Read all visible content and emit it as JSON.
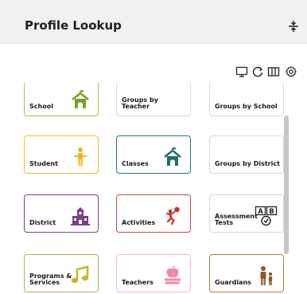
{
  "header": {
    "title": "Profile Lookup"
  },
  "icons": {
    "collapse": "collapse-vertical-icon",
    "monitor": "monitor-icon",
    "refresh": "refresh-icon",
    "columns": "columns-icon",
    "settings": "gear-icon"
  },
  "tiles": [
    {
      "label": "School",
      "icon": "school-building-icon",
      "border": "#b7bd3c",
      "icon_color": "#7a9d2a"
    },
    {
      "label": "Groups by Teacher",
      "icon": "",
      "border": "#d8d8d8",
      "icon_color": ""
    },
    {
      "label": "Groups by School",
      "icon": "",
      "border": "#d8d8d8",
      "icon_color": ""
    },
    {
      "label": "Student",
      "icon": "student-figure-icon",
      "border": "#f2c21b",
      "icon_color": "#f2b21b"
    },
    {
      "label": "Classes",
      "icon": "classroom-building-icon",
      "border": "#1f7c78",
      "icon_color": "#1f6f6a"
    },
    {
      "label": "Groups by District",
      "icon": "",
      "border": "#d8d8d8",
      "icon_color": ""
    },
    {
      "label": "District",
      "icon": "district-building-icon",
      "border": "#7b3e8f",
      "icon_color": "#7b3e8f"
    },
    {
      "label": "Activities",
      "icon": "activities-figure-icon",
      "border": "#c94a48",
      "icon_color": "#d0312d"
    },
    {
      "label": "Assessment Tests",
      "icon": "assessment-ab-icon",
      "border": "#d8d8d8",
      "icon_color": "#222222"
    },
    {
      "label": "Programs & Services",
      "icon": "music-note-icon",
      "border": "#b9b04a",
      "icon_color": "#c7b62c"
    },
    {
      "label": "Teachers",
      "icon": "apple-books-icon",
      "border": "#f3b6c7",
      "icon_color": "#f08aa6"
    },
    {
      "label": "Guardians",
      "icon": "guardians-figures-icon",
      "border": "#b97b3f",
      "icon_color": "#8a5a2b"
    }
  ],
  "tile_icons": {
    "assessment_a": "A",
    "assessment_b": "B"
  },
  "scrollbar": {}
}
